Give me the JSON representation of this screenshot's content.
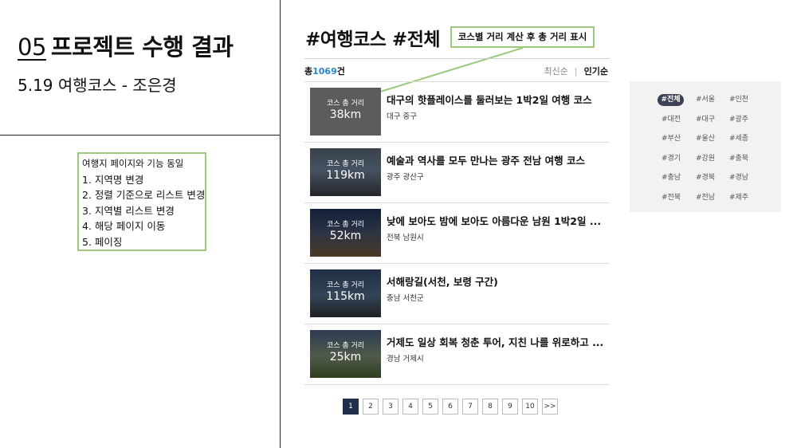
{
  "slide": {
    "number": "05",
    "title": "프로젝트 수행 결과",
    "subtitle": "5.19 여행코스 - 조은경",
    "note_items": [
      "여행지  페이지와 기능 동일",
      "1. 지역명 변경",
      "2. 정렬 기준으로 리스트 변경",
      "3. 지역별 리스트 변경",
      "4. 해당 페이지 이동",
      "5. 페이징"
    ],
    "callout": "코스별 거리 계산 후 총 거리 표시"
  },
  "list": {
    "heading": "#여행코스 #전체",
    "total_prefix": "총",
    "total_count": "1069",
    "total_suffix": "건",
    "sort_options": [
      "최신순",
      "인기순"
    ],
    "sort_selected": "인기순",
    "items": [
      {
        "distance_label": "코스 총 거리",
        "distance": "38km",
        "title": "대구의 핫플레이스를 둘러보는 1박2일 여행 코스",
        "region": "대구 중구"
      },
      {
        "distance_label": "코스 총 거리",
        "distance": "119km",
        "title": "예술과 역사를 모두 만나는 광주 전남 여행 코스",
        "region": "광주 광산구"
      },
      {
        "distance_label": "코스 총 거리",
        "distance": "52km",
        "title": "낮에 보아도 밤에 보아도 아름다운 남원 1박2일 ...",
        "region": "전북 남원시"
      },
      {
        "distance_label": "코스 총 거리",
        "distance": "115km",
        "title": "서해랑길(서천, 보령 구간)",
        "region": "충남 서천군"
      },
      {
        "distance_label": "코스 총 거리",
        "distance": "25km",
        "title": "거제도 일상 회복 청춘 투어, 지친 나를 위로하고 ...",
        "region": "경남 거제시"
      }
    ],
    "pagination": {
      "pages": [
        "1",
        "2",
        "3",
        "4",
        "5",
        "6",
        "7",
        "8",
        "9",
        "10"
      ],
      "current": "1",
      "next": ">>"
    }
  },
  "region_tags": {
    "selected": "#전체",
    "tags": [
      "#전체",
      "#서울",
      "#인천",
      "#대전",
      "#대구",
      "#광주",
      "#부산",
      "#울산",
      "#세종",
      "#경기",
      "#강원",
      "#충북",
      "#충남",
      "#경북",
      "#경남",
      "#전북",
      "#전남",
      "#제주"
    ]
  },
  "colors": {
    "accent_blue": "#2a86c6",
    "callout_border": "#9cc97c",
    "active_tag_bg": "#3c4254",
    "current_page_bg": "#1f2f4c"
  }
}
